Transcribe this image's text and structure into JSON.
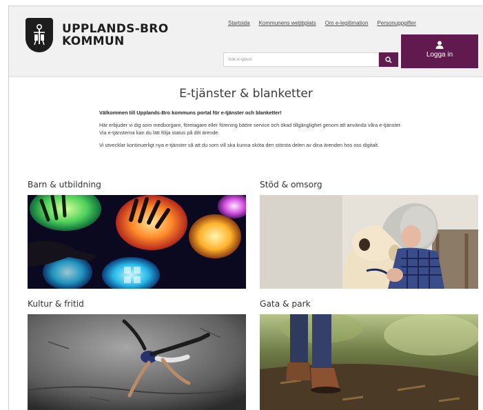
{
  "header": {
    "logo_line1": "UPPLANDS-BRO",
    "logo_line2": "KOMMUN",
    "links": [
      "Startsida",
      "Kommunens webbplats",
      "Om e-legitimation",
      "Personuppgifter"
    ],
    "search_placeholder": "Sök e-tjänst",
    "search_icon": "search-icon",
    "login_icon": "user-icon",
    "login_label": "Logga in",
    "accent": "#611a4d"
  },
  "main": {
    "title": "E-tjänster & blanketter",
    "welcome": "Välkommen till Upplands-Bro kommuns portal för e-tjänster och blanketter!",
    "paragraph1": "Här erbjuder vi dig som medborgare, företagare eller förening bättre service och ökad tillgänglighet genom att använda våra e-tjänster. Via e-tjänsterna kan du lätt följa status på ditt ärende.",
    "paragraph2": "Vi utvecklar kontinuerligt nya e-tjänster så att du som vill ska kunna sköta den största delen av dina ärenden hos oss digitalt."
  },
  "categories": [
    {
      "title": "Barn & utbildning"
    },
    {
      "title": "Stöd & omsorg"
    },
    {
      "title": "Kultur & fritid"
    },
    {
      "title": "Gata & park"
    }
  ]
}
